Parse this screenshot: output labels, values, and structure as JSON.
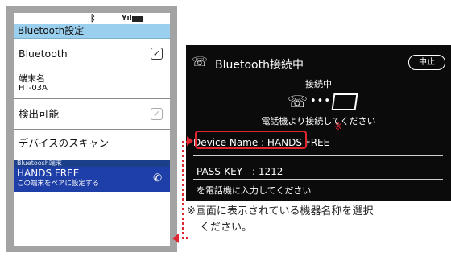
{
  "phone": {
    "status_bar": {
      "bluetooth_icon": "bluetooth-icon",
      "signal_icon": "signal-icon",
      "battery_icon": "battery-icon"
    },
    "header": "Bluetooth設定",
    "rows": {
      "bluetooth": {
        "label": "Bluetooth",
        "checked": true
      },
      "device_name": {
        "label": "端末名",
        "value": "HT-03A"
      },
      "discoverable": {
        "label": "検出可能",
        "checked": false
      },
      "scan": {
        "label": "デバイスのスキャン"
      }
    },
    "category": "Bluetoosh端末",
    "paired_item": {
      "name": "HANDS FREE",
      "subtitle": "この端末をペアに設定する",
      "icon": "phone-handset-icon"
    }
  },
  "dialog": {
    "title": "Bluetooth接続中",
    "cancel_label": "中止",
    "status": "接続中",
    "message": "電話機より接続してください",
    "device_name_line": "Device Name : HANDS FREE",
    "passkey_line": "PASS-KEY　: 1212",
    "instruction": "を電話機に入力してください"
  },
  "annotation": {
    "mark": "※",
    "note_line1": "※画面に表示されている機器名称を選択",
    "note_line2": "ください。",
    "highlight_color": "#e0262f"
  },
  "colors": {
    "header_bg": "#9ad0ee",
    "selected_item_bg": "#1f3fa8",
    "dialog_bg": "#0b0b0b"
  }
}
